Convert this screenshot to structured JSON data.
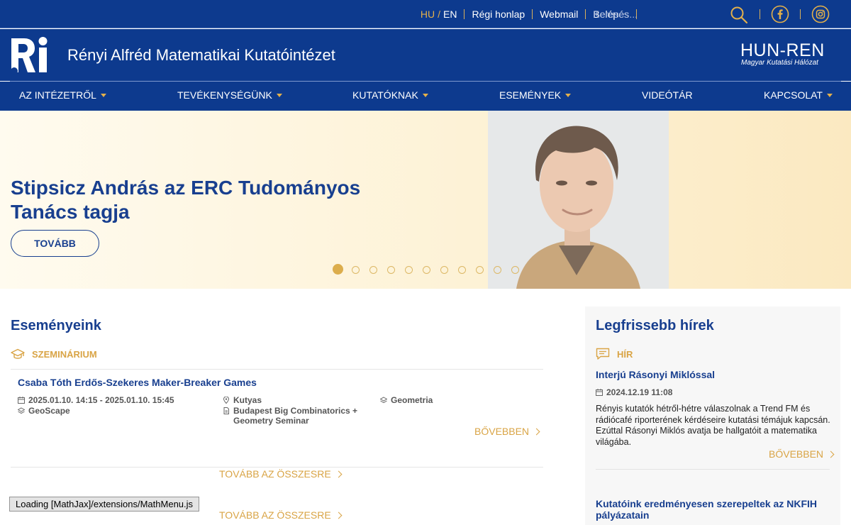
{
  "topbar": {
    "lang_hu": "HU",
    "lang_sep": "/",
    "lang_en": "EN",
    "links": [
      "Régi honlap",
      "Webmail",
      "Belépés"
    ],
    "search_placeholder": "Keresés...",
    "icons": [
      "search-icon",
      "facebook-icon",
      "instagram-icon"
    ]
  },
  "brand": {
    "title": "Rényi Alfréd Matematikai Kutatóintézet",
    "partner": "HUN-REN",
    "partner_sub": "Magyar Kutatási Hálózat"
  },
  "nav": [
    {
      "label": "AZ INTÉZETRŐL",
      "dropdown": true
    },
    {
      "label": "TEVÉKENYSÉGÜNK",
      "dropdown": true
    },
    {
      "label": "KUTATÓKNAK",
      "dropdown": true
    },
    {
      "label": "ESEMÉNYEK",
      "dropdown": true
    },
    {
      "label": "VIDEÓTÁR",
      "dropdown": false
    },
    {
      "label": "KAPCSOLAT",
      "dropdown": true
    }
  ],
  "hero": {
    "headline": "Stipsicz András az ERC Tudományos Tanács tagja",
    "button": "TOVÁBB",
    "slides": 11,
    "active_slide": 1
  },
  "events": {
    "title": "Eseményeink",
    "category": "SZEMINÁRIUM",
    "item": {
      "title": "Csaba Tóth Erdős-Szekeres Maker-Breaker Games",
      "datetime": "2025.01.10. 14:15 - 2025.01.10. 15:45",
      "platform": "GeoScape",
      "location": "Kutyas",
      "series": "Budapest Big Combinatorics + Geometry Seminar",
      "topic": "Geometria",
      "more": "BŐVEBBEN"
    },
    "all_link_1": "TOVÁBB AZ ÖSSZESRE",
    "all_link_2": "TOVÁBB AZ ÖSSZESRE"
  },
  "news": {
    "title": "Legfrissebb hírek",
    "category": "HÍR",
    "item1": {
      "title": "Interjú Rásonyi Miklóssal",
      "date": "2024.12.19 11:08",
      "text": "Rényis kutatók hétről-hétre válaszolnak a Trend FM és rádiócafé riporterének kérdéseire kutatási témájuk kapcsán. Ezúttal Rásonyi Miklós avatja be hallgatóit a matematika világába.",
      "more": "BŐVEBBEN"
    },
    "item2": {
      "title": "Kutatóink eredményesen szerepeltek az NKFIH pályázatain"
    }
  },
  "status": {
    "loading": "Loading [MathJax]/extensions/MathMenu.js"
  },
  "colors": {
    "header_blue": "#0d3a8e",
    "heading_blue": "#183f8f",
    "accent_gold": "#d9a445",
    "hero_cream": "#fdf2d6",
    "panel_gray": "#f7f7f7"
  }
}
